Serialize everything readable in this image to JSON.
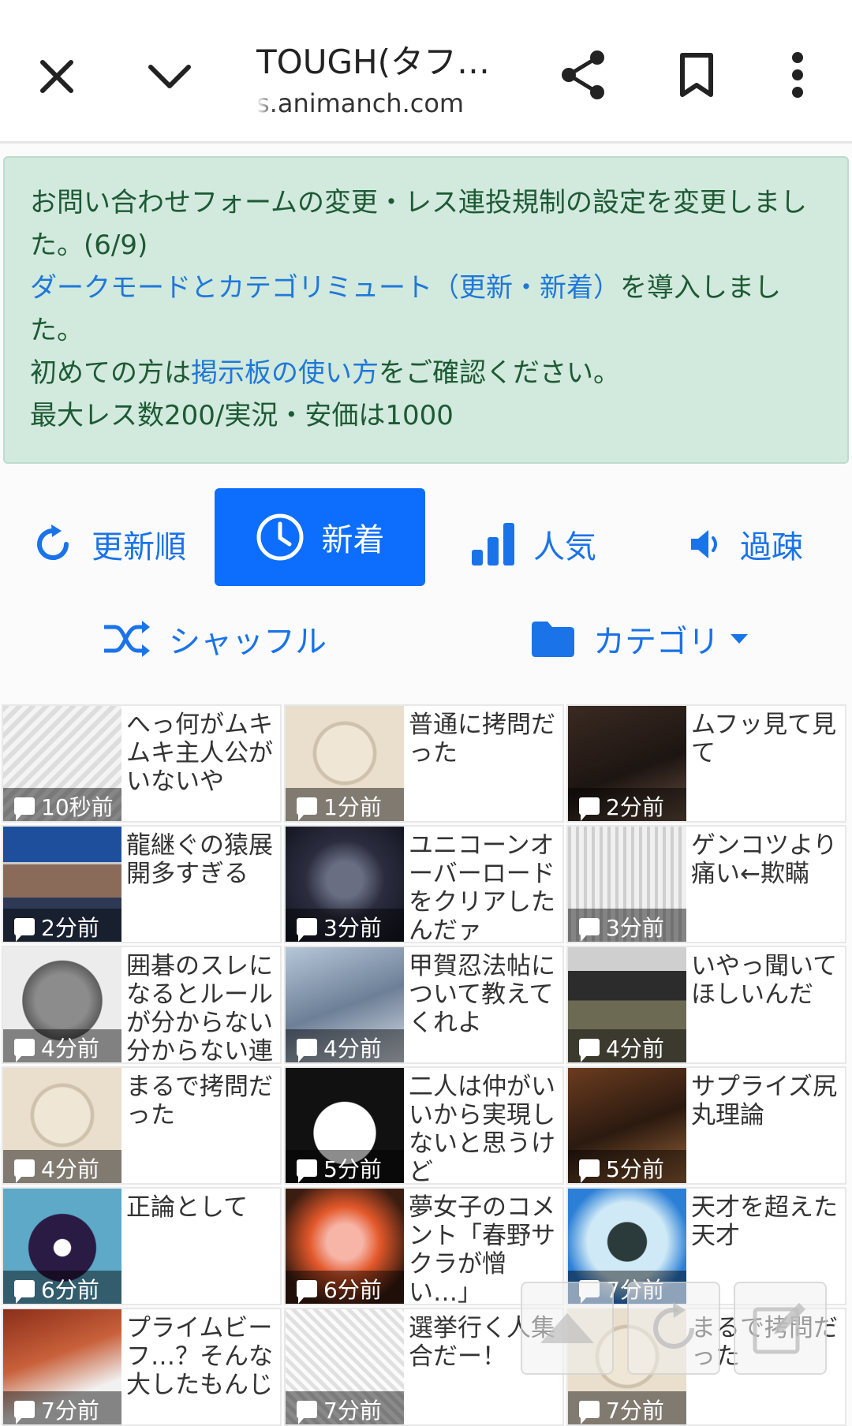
{
  "browser": {
    "title": "TOUGH(タフ…",
    "url": "s.animanch.com"
  },
  "notice": {
    "line1": "お問い合わせフォームの変更・レス連投規制の設定を変更しました。(6/9)",
    "link1": "ダークモードとカテゴリミュート（更新・新着）",
    "line2_suffix": "を導入しました。",
    "line3_prefix": "初めての方は",
    "link2": "掲示板の使い方",
    "line3_suffix": "をご確認ください。",
    "line4": "最大レス数200/実況・安価は1000"
  },
  "sort": {
    "updated": "更新順",
    "new": "新着",
    "popular": "人気",
    "old": "過疎",
    "shuffle": "シャッフル",
    "category": "カテゴリ"
  },
  "threads": [
    {
      "title": "へっ何がムキムキ主人公がいないや",
      "time": "10秒前",
      "thumb": "manga"
    },
    {
      "title": "普通に拷問だった",
      "time": "1分前",
      "thumb": "manga2"
    },
    {
      "title": "ムフッ見て見て",
      "time": "2分前",
      "thumb": "anime1"
    },
    {
      "title": "龍継ぐの猿展開多すぎる",
      "time": "2分前",
      "thumb": "news"
    },
    {
      "title": "ユニコーンオーバーロードをクリアしたんだァ",
      "time": "3分前",
      "thumb": "dark"
    },
    {
      "title": "ゲンコツより痛い←欺瞞",
      "time": "3分前",
      "thumb": "manga3"
    },
    {
      "title": "囲碁のスレになるとルールが分からない分からない連",
      "time": "4分前",
      "thumb": "face"
    },
    {
      "title": "甲賀忍法帖について教えてくれよ",
      "time": "4分前",
      "thumb": "anime2"
    },
    {
      "title": "いやっ聞いてほしいんだ",
      "time": "4分前",
      "thumb": "person"
    },
    {
      "title": "まるで拷問だった",
      "time": "4分前",
      "thumb": "manga2"
    },
    {
      "title": "二人は仲がいいから実現しないと思うけど",
      "time": "5分前",
      "thumb": "bw"
    },
    {
      "title": "サプライズ尻丸理論",
      "time": "5分前",
      "thumb": "movie"
    },
    {
      "title": "正論として",
      "time": "6分前",
      "thumb": "purple"
    },
    {
      "title": "夢女子のコメント「春野サクラが憎い…」",
      "time": "6分前",
      "thumb": "fire"
    },
    {
      "title": "天才を超えた天才",
      "time": "7分前",
      "thumb": "game"
    },
    {
      "title": "プライムビーフ…？そんな大したもんじ",
      "time": "7分前",
      "thumb": "meat"
    },
    {
      "title": "選挙行く人集合だー！",
      "time": "7分前",
      "thumb": "manga4"
    },
    {
      "title": "まるで拷問だった",
      "time": "7分前",
      "thumb": "manga2"
    }
  ],
  "colors": {
    "accent": "#0d6efd",
    "link": "#1a73e8",
    "notice_bg": "#d2e9de",
    "notice_text": "#1d5a34"
  }
}
